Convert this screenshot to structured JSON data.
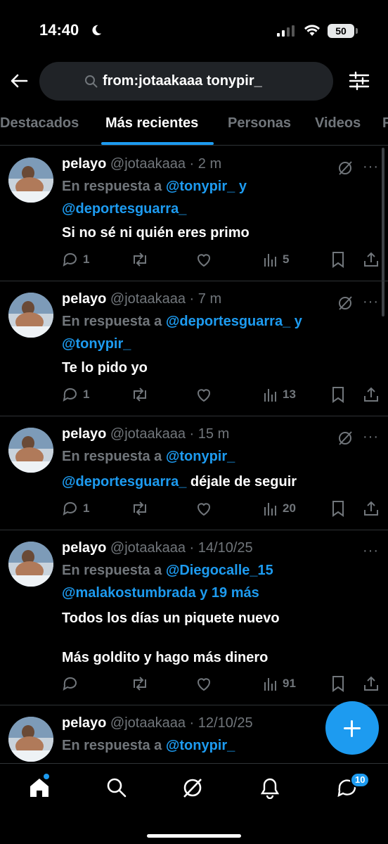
{
  "status_bar": {
    "time": "14:40",
    "battery": "50"
  },
  "header": {
    "search_text": "from:jotaakaaa tonypir_"
  },
  "tabs": [
    {
      "label": "Destacados",
      "active": false
    },
    {
      "label": "Más recientes",
      "active": true
    },
    {
      "label": "Personas",
      "active": false
    },
    {
      "label": "Videos",
      "active": false
    },
    {
      "label": "F",
      "active": false
    }
  ],
  "tweets": [
    {
      "name": "pelayo",
      "handle": "@jotaakaaa",
      "sep": "·",
      "time": "2 m",
      "reply_prefix": "En respuesta a",
      "reply_line1_link": "@tonypir_",
      "reply_line1_suffix": "y",
      "reply_line2_link": "@deportesguarra_",
      "text": "Si no sé ni quién eres primo",
      "replies": "1",
      "retweets": "",
      "likes": "",
      "views": "5"
    },
    {
      "name": "pelayo",
      "handle": "@jotaakaaa",
      "sep": "·",
      "time": "7 m",
      "reply_prefix": "En respuesta a",
      "reply_line1_link": "@deportesguarra_",
      "reply_line1_suffix": "y",
      "reply_line2_link": "@tonypir_",
      "text": "Te lo pido yo",
      "replies": "1",
      "retweets": "",
      "likes": "",
      "views": "13"
    },
    {
      "name": "pelayo",
      "handle": "@jotaakaaa",
      "sep": "·",
      "time": "15 m",
      "reply_prefix": "En respuesta a",
      "reply_line1_link": "@tonypir_",
      "text_link": "@deportesguarra_",
      "text": "déjale de seguir",
      "replies": "1",
      "retweets": "",
      "likes": "",
      "views": "20"
    },
    {
      "name": "pelayo",
      "handle": "@jotaakaaa",
      "sep": "·",
      "time": "14/10/25",
      "reply_prefix": "En respuesta a",
      "reply_line1_link": "@Diegocalle_15",
      "reply_line2_link": "@malakostumbrada",
      "reply_line2_suffix": "y 19 más",
      "text": "Todos los días un piquete nuevo",
      "text2": "Más goldito y hago más dinero",
      "replies": "",
      "retweets": "",
      "likes": "",
      "views": "91"
    },
    {
      "name": "pelayo",
      "handle": "@jotaakaaa",
      "sep": "·",
      "time": "12/10/25",
      "reply_prefix": "En respuesta a",
      "reply_line1_link": "@tonypir_"
    }
  ],
  "bottom_nav": {
    "messages_badge": "10",
    "icons": [
      "home-icon",
      "search-icon",
      "grok-icon",
      "bell-icon",
      "messages-icon"
    ]
  },
  "colors": {
    "accent": "#1d9bf0",
    "text": "#e7e9ea",
    "muted": "#71767b",
    "background": "#000000",
    "divider": "#2f3336"
  }
}
